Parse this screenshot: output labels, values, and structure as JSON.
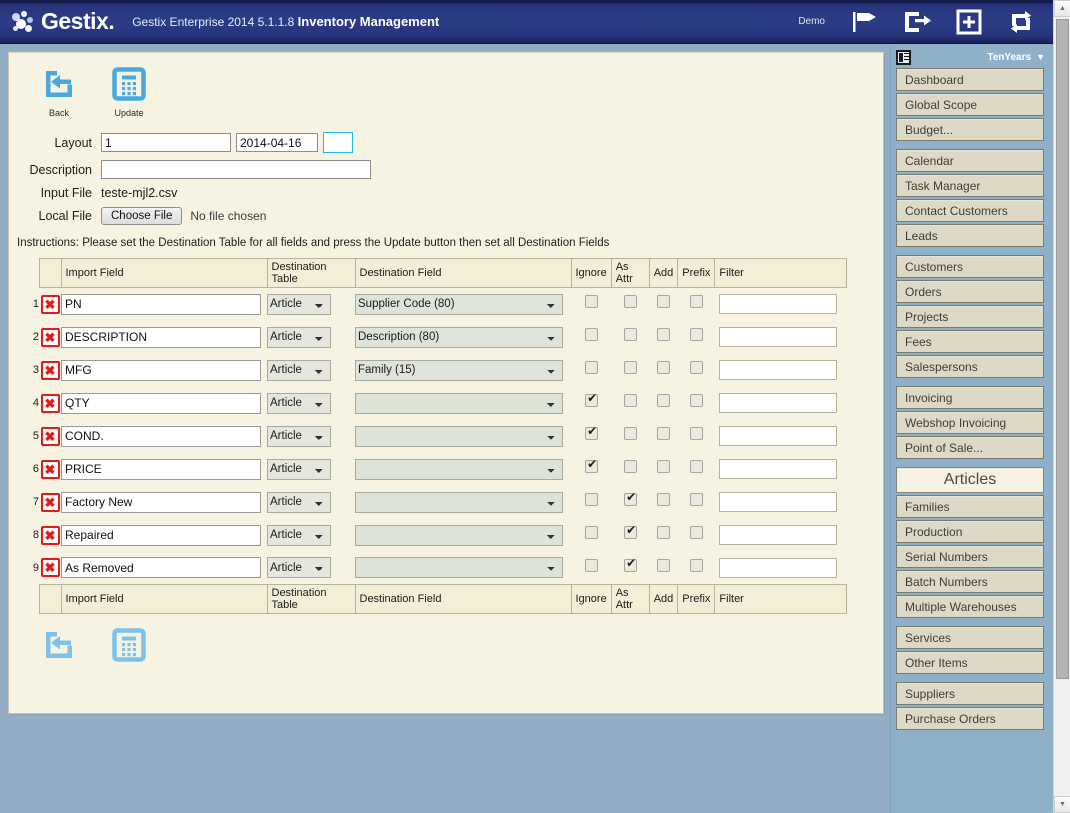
{
  "header": {
    "brand": "Gestix.",
    "product": "Gestix Enterprise 2014 5.1.1.8",
    "module": "Inventory Management",
    "demo_label": "Demo",
    "icons": [
      "flag-icon",
      "logout-icon",
      "plus-icon",
      "sync-icon"
    ]
  },
  "toolbar": {
    "back_label": "Back",
    "update_label": "Update"
  },
  "form": {
    "layout_label": "Layout",
    "layout_value": "1",
    "layout_placeholder": "",
    "date_value": "2014-04-16",
    "date_placeholder": "",
    "description_label": "Description",
    "description_value": "",
    "description_placeholder": "",
    "input_file_label": "Input File",
    "input_file_value": "teste-mjl2.csv",
    "local_file_label": "Local File",
    "choose_file_label": "Choose File",
    "no_file_label": "No file chosen"
  },
  "instructions": "Instructions: Please set the Destination Table for all fields and press the Update button then set all Destination Fields",
  "table": {
    "columns": [
      "",
      "",
      "Import Field",
      "Destination Table",
      "Destination Field",
      "Ignore",
      "As Attr",
      "Add",
      "Prefix",
      "Filter"
    ],
    "headers": {
      "import_field": "Import Field",
      "destination_table": "Destination Table",
      "destination_field": "Destination Field",
      "ignore": "Ignore",
      "as_attr": "As Attr",
      "add": "Add",
      "prefix": "Prefix",
      "filter": "Filter"
    },
    "delete_glyph": "✖",
    "destination_table_options": [
      "Article"
    ],
    "destination_field_options": [
      "",
      "Supplier Code (80)",
      "Description (80)",
      "Family (15)"
    ],
    "rows": [
      {
        "num": "1",
        "import_field": "PN",
        "destination_table": "Article",
        "destination_field": "Supplier Code (80)",
        "ignore": false,
        "as_attr": false,
        "add": false,
        "prefix": false,
        "filter": ""
      },
      {
        "num": "2",
        "import_field": "DESCRIPTION",
        "destination_table": "Article",
        "destination_field": "Description (80)",
        "ignore": false,
        "as_attr": false,
        "add": false,
        "prefix": false,
        "filter": ""
      },
      {
        "num": "3",
        "import_field": "MFG",
        "destination_table": "Article",
        "destination_field": "Family (15)",
        "ignore": false,
        "as_attr": false,
        "add": false,
        "prefix": false,
        "filter": ""
      },
      {
        "num": "4",
        "import_field": "QTY",
        "destination_table": "Article",
        "destination_field": "",
        "ignore": true,
        "as_attr": false,
        "add": false,
        "prefix": false,
        "filter": ""
      },
      {
        "num": "5",
        "import_field": "COND.",
        "destination_table": "Article",
        "destination_field": "",
        "ignore": true,
        "as_attr": false,
        "add": false,
        "prefix": false,
        "filter": ""
      },
      {
        "num": "6",
        "import_field": "PRICE",
        "destination_table": "Article",
        "destination_field": "",
        "ignore": true,
        "as_attr": false,
        "add": false,
        "prefix": false,
        "filter": ""
      },
      {
        "num": "7",
        "import_field": "Factory New",
        "destination_table": "Article",
        "destination_field": "",
        "ignore": false,
        "as_attr": true,
        "add": false,
        "prefix": false,
        "filter": ""
      },
      {
        "num": "8",
        "import_field": "Repaired",
        "destination_table": "Article",
        "destination_field": "",
        "ignore": false,
        "as_attr": true,
        "add": false,
        "prefix": false,
        "filter": ""
      },
      {
        "num": "9",
        "import_field": "As Removed",
        "destination_table": "Article",
        "destination_field": "",
        "ignore": false,
        "as_attr": true,
        "add": false,
        "prefix": false,
        "filter": ""
      }
    ]
  },
  "sidebar": {
    "panel_icon": "panel-toggle-icon",
    "scope_label": "TenYears",
    "scope_caret": "▼",
    "groups": [
      {
        "items": [
          {
            "label": "Dashboard",
            "type": "item"
          },
          {
            "label": "Global Scope",
            "type": "item"
          },
          {
            "label": "Budget...",
            "type": "item"
          }
        ]
      },
      {
        "items": [
          {
            "label": "Calendar",
            "type": "item"
          },
          {
            "label": "Task Manager",
            "type": "item"
          },
          {
            "label": "Contact Customers",
            "type": "item"
          },
          {
            "label": "Leads",
            "type": "item"
          }
        ]
      },
      {
        "items": [
          {
            "label": "Customers",
            "type": "item"
          },
          {
            "label": "Orders",
            "type": "item"
          },
          {
            "label": "Projects",
            "type": "item"
          },
          {
            "label": "Fees",
            "type": "item"
          },
          {
            "label": "Salespersons",
            "type": "item"
          }
        ]
      },
      {
        "items": [
          {
            "label": "Invoicing",
            "type": "item"
          },
          {
            "label": "Webshop Invoicing",
            "type": "item"
          },
          {
            "label": "Point of Sale...",
            "type": "item"
          }
        ]
      },
      {
        "items": [
          {
            "label": "Articles",
            "type": "section"
          },
          {
            "label": "Families",
            "type": "item"
          },
          {
            "label": "Production",
            "type": "item"
          },
          {
            "label": "Serial Numbers",
            "type": "item"
          },
          {
            "label": "Batch Numbers",
            "type": "item"
          },
          {
            "label": "Multiple Warehouses",
            "type": "item"
          }
        ]
      },
      {
        "items": [
          {
            "label": "Services",
            "type": "item"
          },
          {
            "label": "Other Items",
            "type": "item"
          }
        ]
      },
      {
        "items": [
          {
            "label": "Suppliers",
            "type": "item"
          },
          {
            "label": "Purchase Orders",
            "type": "item"
          }
        ]
      }
    ]
  },
  "scrollbar": {
    "up_glyph": "▲",
    "down_glyph": "▼"
  },
  "colors": {
    "header_blue": "#2c3c86",
    "page_bg": "#93aec4",
    "panel_bg": "#f7f3e3",
    "sidebar_bg": "#8fb0c9",
    "sidebar_item": "#ded9c6",
    "icon_blue": "#49a8e0",
    "delete_red": "#e01b1b",
    "date_cyan": "#12b5e8"
  }
}
